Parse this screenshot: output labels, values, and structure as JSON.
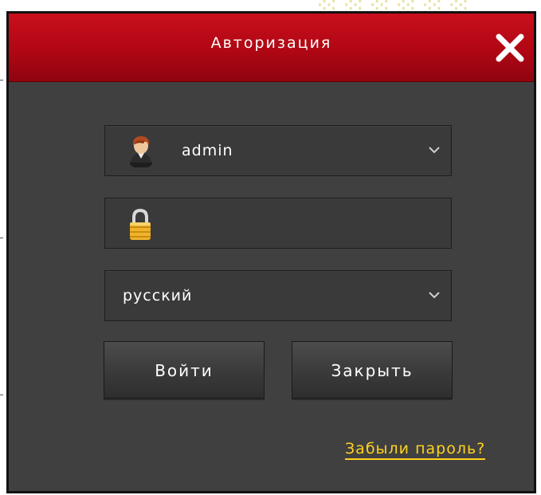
{
  "dialog": {
    "title": "Авторизация",
    "close_icon": "close-x-icon"
  },
  "form": {
    "username": {
      "value": "admin",
      "icon": "user-avatar-icon"
    },
    "password": {
      "value": "",
      "placeholder": "",
      "icon": "padlock-icon"
    },
    "language": {
      "value": "русский"
    }
  },
  "buttons": {
    "login_label": "Войти",
    "close_label": "Закрыть"
  },
  "forgot_link": "Забыли пароль?",
  "colors": {
    "titlebar": "#b00713",
    "panel": "#404040",
    "link": "#ffd21e"
  }
}
